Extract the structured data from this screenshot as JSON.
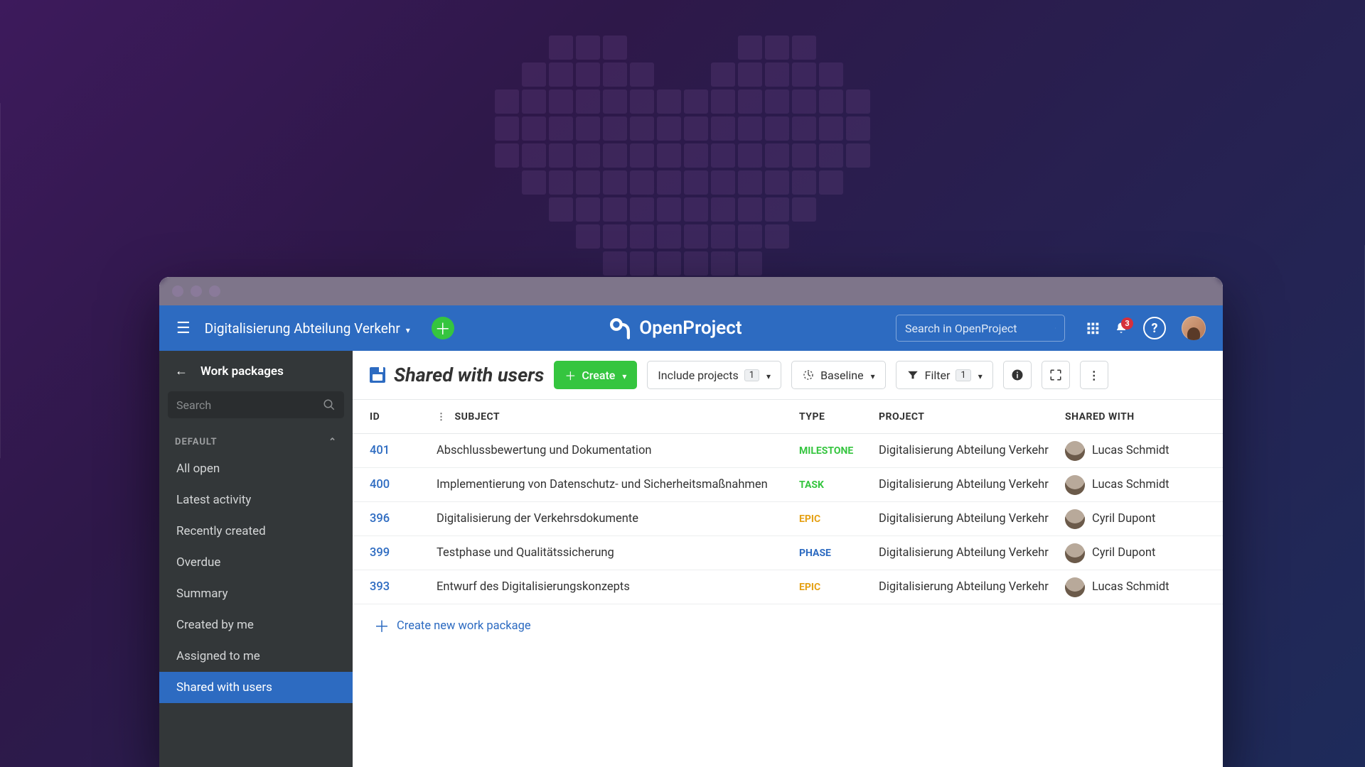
{
  "topbar": {
    "project_name": "Digitalisierung Abteilung Verkehr",
    "brand": "OpenProject",
    "search_placeholder": "Search in OpenProject",
    "notification_count": "3"
  },
  "sidebar": {
    "title": "Work packages",
    "search_placeholder": "Search",
    "group_label": "DEFAULT",
    "items": {
      "0": {
        "label": "All open"
      },
      "1": {
        "label": "Latest activity"
      },
      "2": {
        "label": "Recently created"
      },
      "3": {
        "label": "Overdue"
      },
      "4": {
        "label": "Summary"
      },
      "5": {
        "label": "Created by me"
      },
      "6": {
        "label": "Assigned to me"
      },
      "7": {
        "label": "Shared with users"
      }
    }
  },
  "toolbar": {
    "view_title": "Shared with users",
    "create_label": "Create",
    "include_projects_label": "Include projects",
    "include_projects_count": "1",
    "baseline_label": "Baseline",
    "filter_label": "Filter",
    "filter_count": "1"
  },
  "columns": {
    "id": "ID",
    "subject": "SUBJECT",
    "type": "TYPE",
    "project": "PROJECT",
    "shared_with": "SHARED WITH"
  },
  "rows": {
    "0": {
      "id": "401",
      "subject": "Abschlussbewertung und Dokumentation",
      "type": "MILESTONE",
      "type_class": "milestone",
      "project": "Digitalisierung Abteilung Verkehr",
      "shared_with": "Lucas Schmidt"
    },
    "1": {
      "id": "400",
      "subject": "Implementierung von Datenschutz- und Sicherheitsmaßnahmen",
      "type": "TASK",
      "type_class": "task",
      "project": "Digitalisierung Abteilung Verkehr",
      "shared_with": "Lucas Schmidt"
    },
    "2": {
      "id": "396",
      "subject": "Digitalisierung der Verkehrsdokumente",
      "type": "EPIC",
      "type_class": "epic",
      "project": "Digitalisierung Abteilung Verkehr",
      "shared_with": "Cyril Dupont"
    },
    "3": {
      "id": "399",
      "subject": "Testphase und Qualitätssicherung",
      "type": "PHASE",
      "type_class": "phase",
      "project": "Digitalisierung Abteilung Verkehr",
      "shared_with": "Cyril Dupont"
    },
    "4": {
      "id": "393",
      "subject": "Entwurf des Digitalisierungskonzepts",
      "type": "EPIC",
      "type_class": "epic",
      "project": "Digitalisierung Abteilung Verkehr",
      "shared_with": "Lucas Schmidt"
    }
  },
  "create_row_label": "Create new work package"
}
